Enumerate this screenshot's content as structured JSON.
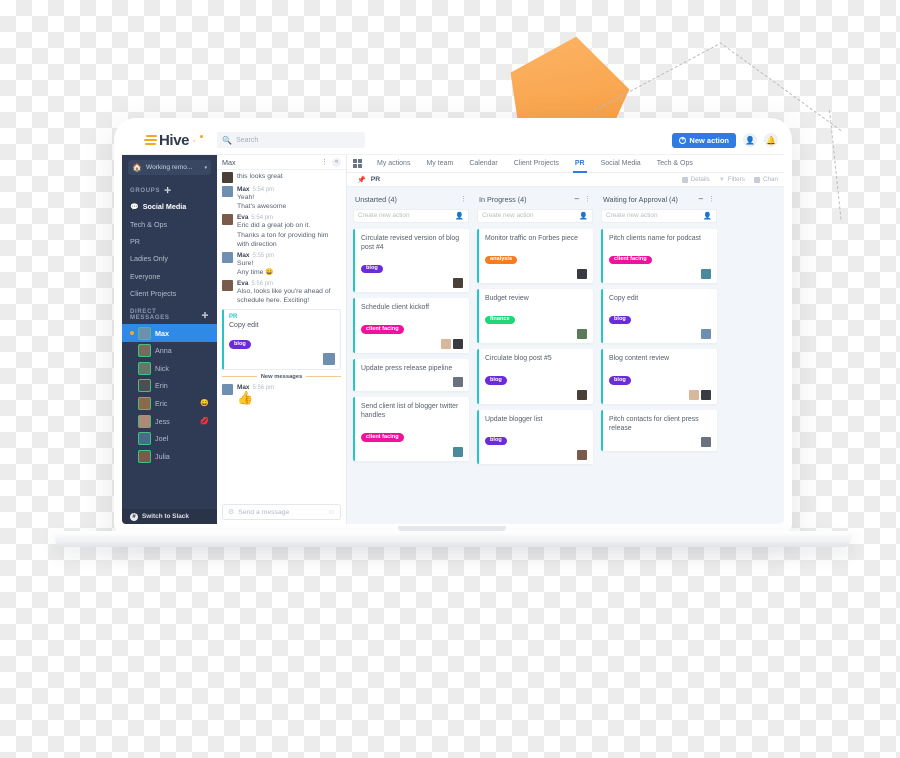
{
  "app": {
    "logo_text": "Hive",
    "search_placeholder": "Search",
    "new_action_label": "New action",
    "invite_icon": "invite-person-icon",
    "bell_icon": "notification-bell-icon"
  },
  "sidebar": {
    "status": {
      "emoji": "🏠",
      "text": "Working remo...",
      "caret": "▾"
    },
    "groups_header": "GROUPS",
    "groups_add": "✛",
    "groups": [
      {
        "label": "Social Media",
        "active": true,
        "bubble": "💬"
      },
      {
        "label": "Tech & Ops",
        "active": false
      },
      {
        "label": "PR",
        "active": false
      },
      {
        "label": "Ladies Only",
        "active": false
      },
      {
        "label": "Everyone",
        "active": false
      },
      {
        "label": "Client Projects",
        "active": false
      }
    ],
    "dm_header": "DIRECT MESSAGES",
    "dm_add": "✛",
    "dms": [
      {
        "name": "Max",
        "selected": true,
        "unread": true,
        "trail": "",
        "color": "#6f8fb0"
      },
      {
        "name": "Anna",
        "selected": false,
        "unread": false,
        "trail": "",
        "color": "#7a6a5e"
      },
      {
        "name": "Nick",
        "selected": false,
        "unread": false,
        "trail": "",
        "color": "#5f7a6a"
      },
      {
        "name": "Erin",
        "selected": false,
        "unread": false,
        "trail": "",
        "color": "#4a4f56"
      },
      {
        "name": "Eric",
        "selected": false,
        "unread": false,
        "trail": "😄",
        "color": "#8a6a4a"
      },
      {
        "name": "Jess",
        "selected": false,
        "unread": false,
        "trail": "💋",
        "color": "#b08878"
      },
      {
        "name": "Joel",
        "selected": false,
        "unread": false,
        "trail": "",
        "color": "#4a6a8a"
      },
      {
        "name": "Julia",
        "selected": false,
        "unread": false,
        "trail": "",
        "color": "#7a5a4a"
      }
    ],
    "switch_slack": "Switch to Slack"
  },
  "chat": {
    "title": "Max",
    "kebab": "⋮",
    "collapse": "«",
    "messages": [
      {
        "avatar": true,
        "color": "#4a4038",
        "name": "",
        "time": "",
        "lines": [
          "this looks great"
        ]
      },
      {
        "avatar": true,
        "color": "#6f8fb0",
        "name": "Max",
        "time": "5:54 pm",
        "lines": [
          "Yeah!",
          "That's awesome"
        ]
      },
      {
        "avatar": true,
        "color": "#7a5a4a",
        "name": "Eva",
        "time": "5:54 pm",
        "lines": [
          "Eric did a great job on it.",
          "Thanks a ton for providing him with direction"
        ]
      },
      {
        "avatar": true,
        "color": "#6f8fb0",
        "name": "Max",
        "time": "5:55 pm",
        "lines": [
          "Sure!",
          "Any time 😄"
        ]
      },
      {
        "avatar": true,
        "color": "#7a5a4a",
        "name": "Eva",
        "time": "5:56 pm",
        "lines": [
          "Also, looks like you're ahead of schedule here. Exciting!"
        ]
      }
    ],
    "embed_card": {
      "project": "PR",
      "title": "Copy edit",
      "tag": {
        "label": "blog",
        "color": "#6c2bd9"
      }
    },
    "new_messages_label": "New messages",
    "last_message": {
      "name": "Max",
      "time": "5:56 pm",
      "emoji": "👍",
      "color": "#6f8fb0"
    },
    "composer_placeholder": "Send a message",
    "composer_add_icon": "add-attachment-icon",
    "composer_emoji_icon": "emoji-icon"
  },
  "board": {
    "grid_icon": "grid-view-icon",
    "tabs": [
      {
        "label": "My actions",
        "active": false
      },
      {
        "label": "My team",
        "active": false
      },
      {
        "label": "Calendar",
        "active": false
      },
      {
        "label": "Client Projects",
        "active": false
      },
      {
        "label": "PR",
        "active": true
      },
      {
        "label": "Social Media",
        "active": false
      },
      {
        "label": "Tech & Ops",
        "active": false
      }
    ],
    "subbar": {
      "pin_icon": "pin-icon",
      "title": "PR",
      "actions": [
        {
          "label": "Details",
          "icon": "details-icon"
        },
        {
          "label": "Filters",
          "icon": "filter-funnel-icon"
        },
        {
          "label": "Chan",
          "icon": "channels-icon"
        }
      ]
    },
    "new_action_placeholder": "Create new action",
    "assign_icon": "assign-person-icon",
    "columns": [
      {
        "title": "Unstarted (4)",
        "has_collapse": false,
        "cards": [
          {
            "title": "Circulate revised version of blog post #4",
            "tag": {
              "label": "blog",
              "color": "#6c2bd9"
            },
            "avatars": [
              "#4a4038"
            ]
          },
          {
            "title": "Schedule client kickoff",
            "tag": {
              "label": "client facing",
              "color": "#f0119c"
            },
            "avatars": [
              "#d8b89c",
              "#3a3a42"
            ]
          },
          {
            "title": "Update press release pipeline",
            "tag": null,
            "avatars": [
              "#6a7280"
            ]
          },
          {
            "title": "Send client list of blogger twitter handles",
            "tag": {
              "label": "client facing",
              "color": "#f0119c"
            },
            "avatars": [
              "#4a8a9a"
            ]
          }
        ]
      },
      {
        "title": "In Progress (4)",
        "has_collapse": true,
        "cards": [
          {
            "title": "Monitor traffic on Forbes piece",
            "tag": {
              "label": "analysis",
              "color": "#f57c1f"
            },
            "avatars": [
              "#3a3a42"
            ]
          },
          {
            "title": "Budget review",
            "tag": {
              "label": "finance",
              "color": "#1fd67a"
            },
            "avatars": [
              "#5a7a5a"
            ]
          },
          {
            "title": "Circulate blog post #5",
            "tag": {
              "label": "blog",
              "color": "#6c2bd9"
            },
            "avatars": [
              "#4a4038"
            ]
          },
          {
            "title": "Update blogger list",
            "tag": {
              "label": "blog",
              "color": "#6c2bd9"
            },
            "avatars": [
              "#7a5a4a"
            ]
          }
        ]
      },
      {
        "title": "Waiting for Approval (4)",
        "has_collapse": true,
        "cards": [
          {
            "title": "Pitch clients name for podcast",
            "tag": {
              "label": "client facing",
              "color": "#f0119c"
            },
            "avatars": [
              "#4a8a9a"
            ]
          },
          {
            "title": "Copy edit",
            "tag": {
              "label": "blog",
              "color": "#6c2bd9"
            },
            "avatars": [
              "#6f8fb0"
            ]
          },
          {
            "title": "Blog content review",
            "tag": {
              "label": "blog",
              "color": "#6c2bd9"
            },
            "avatars": [
              "#d8b89c",
              "#3a3a42"
            ]
          },
          {
            "title": "Pitch contacts for client press release",
            "tag": null,
            "avatars": [
              "#6a7280"
            ]
          }
        ]
      }
    ]
  },
  "theme": {
    "brand_orange": "#f5a623",
    "accent_blue": "#2e7be4",
    "sidebar_bg": "#2f3b54",
    "card_accent": "#27c5c8",
    "board_bg": "#f2f6fa"
  }
}
